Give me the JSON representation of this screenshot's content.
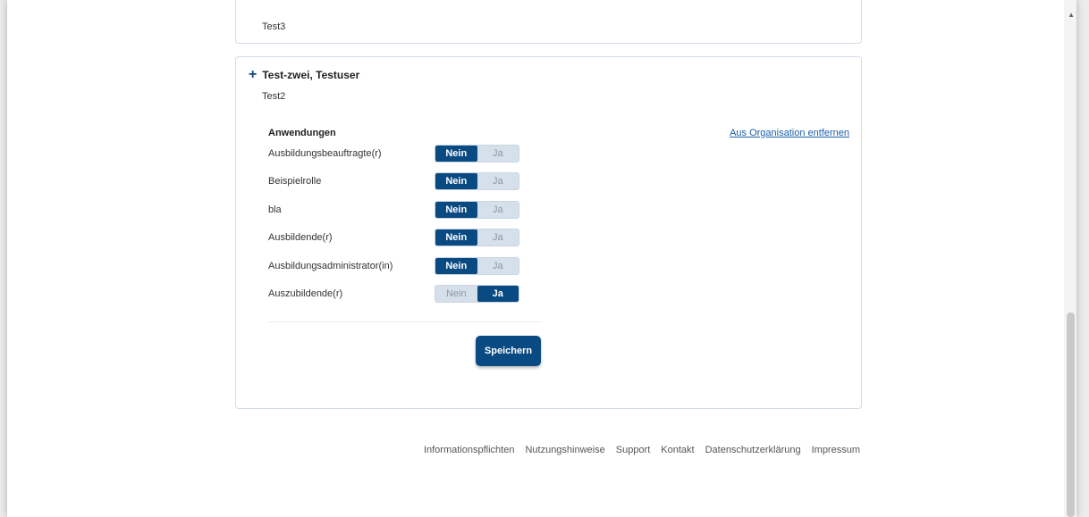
{
  "cards": {
    "previous": {
      "subtitle": "Test3"
    },
    "current": {
      "name": "Test-zwei, Testuser",
      "subtitle": "Test2",
      "expand_icon": "plus-icon",
      "section_title": "Anwendungen",
      "remove_link": "Aus Organisation entfernen",
      "option_no": "Nein",
      "option_yes": "Ja",
      "roles": [
        {
          "label": "Ausbildungsbeauftragte(r)",
          "selected": "Nein"
        },
        {
          "label": "Beispielrolle",
          "selected": "Nein"
        },
        {
          "label": "bla",
          "selected": "Nein"
        },
        {
          "label": "Ausbildende(r)",
          "selected": "Nein"
        },
        {
          "label": "Ausbildungsadministrator(in)",
          "selected": "Nein"
        },
        {
          "label": "Auszubildende(r)",
          "selected": "Ja"
        }
      ],
      "save_label": "Speichern"
    }
  },
  "footer": {
    "links": [
      "Informationspflichten",
      "Nutzungshinweise",
      "Support",
      "Kontakt",
      "Datenschutzerklärung",
      "Impressum"
    ]
  },
  "colors": {
    "primary": "#0a4a82",
    "toggle_off": "#d6e0ea",
    "link": "#1a5fa8"
  }
}
